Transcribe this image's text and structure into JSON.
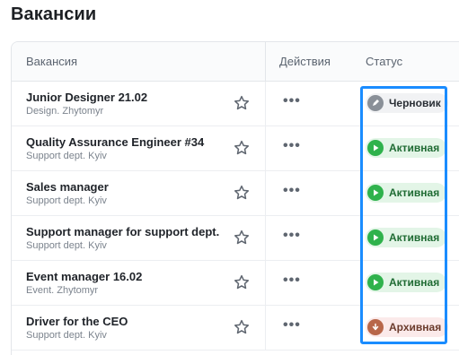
{
  "page": {
    "title": "Вакансии"
  },
  "table": {
    "headers": {
      "vacancy": "Вакансия",
      "actions": "Действия",
      "status": "Статус"
    },
    "rows": [
      {
        "title": "Junior Designer 21.02",
        "subtitle": "Design. Zhytomyr",
        "status": "Черновик",
        "status_type": "draft"
      },
      {
        "title": "Quality Assurance Engineer #34",
        "subtitle": "Support dept. Kyiv",
        "status": "Активная",
        "status_type": "active"
      },
      {
        "title": "Sales manager",
        "subtitle": "Support dept. Kyiv",
        "status": "Активная",
        "status_type": "active"
      },
      {
        "title": "Support manager for support dept.",
        "subtitle": "Support dept. Kyiv",
        "status": "Активная",
        "status_type": "active"
      },
      {
        "title": "Event manager 16.02",
        "subtitle": "Event. Zhytomyr",
        "status": "Активная",
        "status_type": "active"
      },
      {
        "title": "Driver for the CEO",
        "subtitle": "Support dept. Kyiv",
        "status": "Архивная",
        "status_type": "archived"
      }
    ],
    "row_actions_glyph": "•••"
  },
  "colors": {
    "highlight": "#1a8cff",
    "active": "#2fb24c",
    "draft": "#8a9098",
    "archived": "#b8674a"
  },
  "icons": {
    "favorite": "star-icon",
    "draft": "pencil-icon",
    "active": "play-icon",
    "archived": "arrow-down-icon"
  }
}
